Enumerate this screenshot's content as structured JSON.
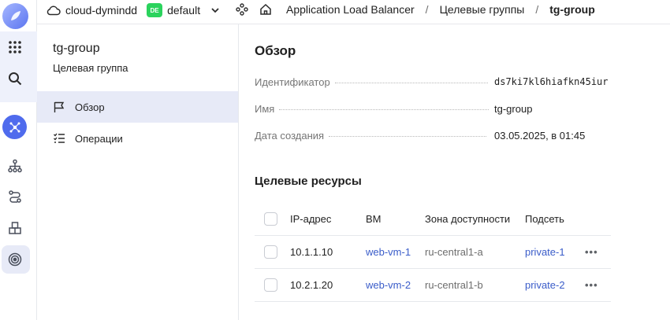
{
  "topbar": {
    "cloud_name": "cloud-dymindd",
    "folder_badge": "DE",
    "folder_name": "default",
    "breadcrumbs": [
      "Application Load Balancer",
      "Целевые группы",
      "tg-group"
    ]
  },
  "sidebar": {
    "title": "tg-group",
    "subtitle": "Целевая группа",
    "items": [
      {
        "label": "Обзор",
        "icon": "flag-icon",
        "active": true
      },
      {
        "label": "Операции",
        "icon": "list-check-icon",
        "active": false
      }
    ]
  },
  "overview": {
    "heading": "Обзор",
    "fields": [
      {
        "key": "Идентификатор",
        "value": "ds7ki7kl6hiafkn45iur"
      },
      {
        "key": "Имя",
        "value": "tg-group"
      },
      {
        "key": "Дата создания",
        "value": "03.05.2025, в 01:45"
      }
    ]
  },
  "targets": {
    "heading": "Целевые ресурсы",
    "columns": [
      "IP-адрес",
      "ВМ",
      "Зона доступности",
      "Подсеть"
    ],
    "rows": [
      {
        "ip": "10.1.1.10",
        "vm": "web-vm-1",
        "zone": "ru-central1-a",
        "subnet": "private-1"
      },
      {
        "ip": "10.2.1.20",
        "vm": "web-vm-2",
        "zone": "ru-central1-b",
        "subnet": "private-2"
      }
    ],
    "row_menu": "•••"
  },
  "colors": {
    "accent": "#4f6bed",
    "link": "#3a5cc9",
    "badge": "#2bd35d",
    "selected_bg": "#e7eaf7"
  }
}
